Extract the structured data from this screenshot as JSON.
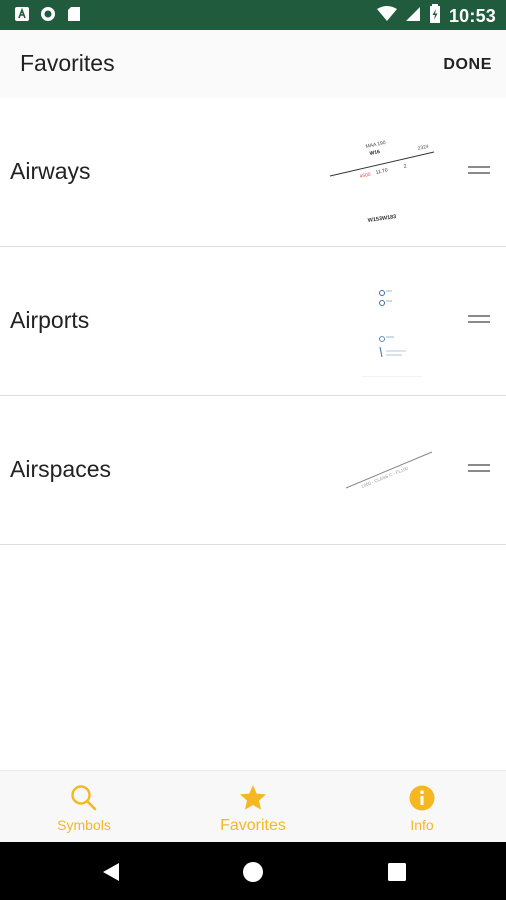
{
  "status_bar": {
    "time": "10:53",
    "icons": [
      "a-notification-icon",
      "circle-notification-icon",
      "sd-card-icon",
      "wifi-icon",
      "signal-icon",
      "battery-icon"
    ],
    "background": "#1f5b3c"
  },
  "header": {
    "title": "Favorites",
    "done_label": "DONE"
  },
  "favorites": [
    {
      "label": "Airways",
      "thumbnail": {
        "icon": "airways-chart-preview-icon",
        "texts": [
          "MAA 190",
          "W16",
          "2324",
          "4500",
          "11.70",
          "2",
          "W153W183"
        ]
      }
    },
    {
      "label": "Airports",
      "thumbnail": {
        "icon": "airports-chart-preview-icon"
      }
    },
    {
      "label": "Airspaces",
      "thumbnail": {
        "icon": "airspaces-chart-preview-icon",
        "texts": [
          "1000 - CLASS C - FL100"
        ]
      }
    }
  ],
  "tab_bar": {
    "accent": "#f5b820",
    "tabs": [
      {
        "label": "Symbols",
        "icon": "search-icon",
        "active": false
      },
      {
        "label": "Favorites",
        "icon": "star-icon",
        "active": true
      },
      {
        "label": "Info",
        "icon": "info-icon",
        "active": false
      }
    ]
  },
  "nav_bar": {
    "buttons": [
      "back-icon",
      "home-icon",
      "recents-icon"
    ]
  }
}
